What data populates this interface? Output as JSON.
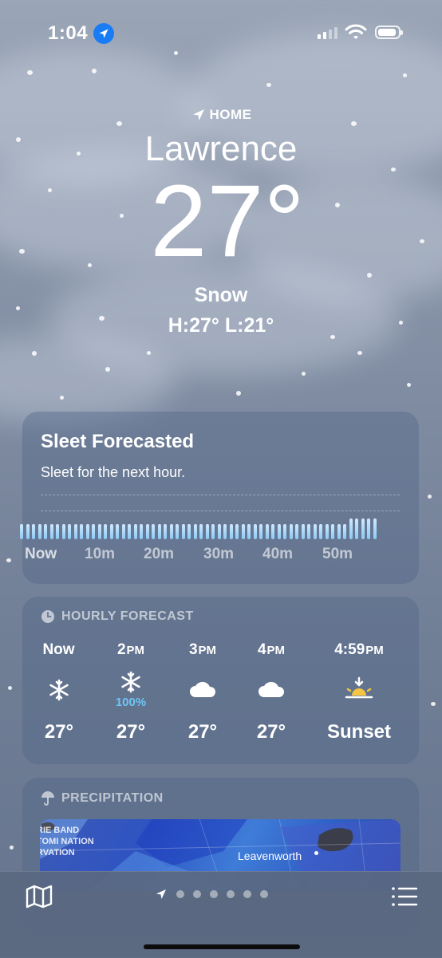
{
  "status_bar": {
    "time": "1:04"
  },
  "header": {
    "home_label": "HOME",
    "city": "Lawrence",
    "temperature": "27°",
    "condition": "Snow",
    "hi_lo": "H:27°  L:21°"
  },
  "sleet_card": {
    "title": "Sleet Forecasted",
    "subtitle": "Sleet for the next hour.",
    "ticks": [
      "Now",
      "10m",
      "20m",
      "30m",
      "40m",
      "50m"
    ]
  },
  "hourly_card": {
    "heading": "HOURLY FORECAST",
    "hours": [
      {
        "time": "Now",
        "ampm": "",
        "icon": "snowflake-icon",
        "pct": "",
        "temp": "27°"
      },
      {
        "time": "2",
        "ampm": "PM",
        "icon": "snowflake-icon",
        "pct": "100%",
        "temp": "27°"
      },
      {
        "time": "3",
        "ampm": "PM",
        "icon": "cloud-icon",
        "pct": "",
        "temp": "27°"
      },
      {
        "time": "4",
        "ampm": "PM",
        "icon": "cloud-icon",
        "pct": "",
        "temp": "27°"
      },
      {
        "time": "4:59",
        "ampm": "PM",
        "icon": "sunset-icon",
        "pct": "",
        "temp": "Sunset"
      }
    ]
  },
  "precip_card": {
    "heading": "PRECIPITATION",
    "map_labels": [
      "RIE BAND",
      "TOMI NATION",
      "RVATION"
    ],
    "map_city": "Leavenworth"
  },
  "colors": {
    "accent_percent": "#6fc4f4",
    "location_blue": "#1a7cf5"
  }
}
